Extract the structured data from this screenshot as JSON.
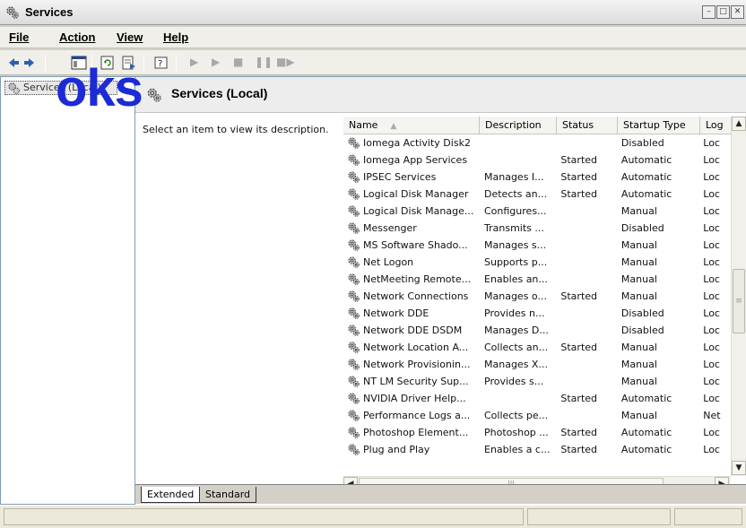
{
  "window": {
    "title": "Services",
    "buttons": [
      "minimize",
      "restore",
      "close"
    ]
  },
  "logo": {
    "text": "oks"
  },
  "menu": {
    "file": "File",
    "action": "Action",
    "view": "View",
    "help": "Help"
  },
  "toolbar": {
    "icons": [
      "back-icon",
      "forward-icon",
      "console-tree-icon",
      "refresh-icon",
      "export-icon",
      "help-icon",
      "start-icon",
      "play-icon",
      "stop-icon",
      "pause-icon",
      "restart-icon"
    ]
  },
  "tree": {
    "item_label": "Services (Local)"
  },
  "pane": {
    "title": "Services (Local)",
    "description": "Select an item to view its description."
  },
  "columns": {
    "name": "Name",
    "description": "Description",
    "status": "Status",
    "startup": "Startup Type",
    "logon": "Log"
  },
  "rows": [
    {
      "name": "Iomega Activity Disk2",
      "description": "",
      "status": "",
      "startup": "Disabled",
      "logon": "Loc"
    },
    {
      "name": "Iomega App Services",
      "description": "",
      "status": "Started",
      "startup": "Automatic",
      "logon": "Loc"
    },
    {
      "name": "IPSEC Services",
      "description": "Manages I...",
      "status": "Started",
      "startup": "Automatic",
      "logon": "Loc"
    },
    {
      "name": "Logical Disk Manager",
      "description": "Detects an...",
      "status": "Started",
      "startup": "Automatic",
      "logon": "Loc"
    },
    {
      "name": "Logical Disk Manage...",
      "description": "Configures...",
      "status": "",
      "startup": "Manual",
      "logon": "Loc"
    },
    {
      "name": "Messenger",
      "description": "Transmits ...",
      "status": "",
      "startup": "Disabled",
      "logon": "Loc"
    },
    {
      "name": "MS Software Shado...",
      "description": "Manages s...",
      "status": "",
      "startup": "Manual",
      "logon": "Loc"
    },
    {
      "name": "Net Logon",
      "description": "Supports p...",
      "status": "",
      "startup": "Manual",
      "logon": "Loc"
    },
    {
      "name": "NetMeeting Remote...",
      "description": "Enables an...",
      "status": "",
      "startup": "Manual",
      "logon": "Loc"
    },
    {
      "name": "Network Connections",
      "description": "Manages o...",
      "status": "Started",
      "startup": "Manual",
      "logon": "Loc"
    },
    {
      "name": "Network DDE",
      "description": "Provides n...",
      "status": "",
      "startup": "Disabled",
      "logon": "Loc"
    },
    {
      "name": "Network DDE DSDM",
      "description": "Manages D...",
      "status": "",
      "startup": "Disabled",
      "logon": "Loc"
    },
    {
      "name": "Network Location A...",
      "description": "Collects an...",
      "status": "Started",
      "startup": "Manual",
      "logon": "Loc"
    },
    {
      "name": "Network Provisionin...",
      "description": "Manages X...",
      "status": "",
      "startup": "Manual",
      "logon": "Loc"
    },
    {
      "name": "NT LM Security Sup...",
      "description": "Provides s...",
      "status": "",
      "startup": "Manual",
      "logon": "Loc"
    },
    {
      "name": "NVIDIA Driver Help...",
      "description": "",
      "status": "Started",
      "startup": "Automatic",
      "logon": "Loc"
    },
    {
      "name": "Performance Logs a...",
      "description": "Collects pe...",
      "status": "",
      "startup": "Manual",
      "logon": "Net"
    },
    {
      "name": "Photoshop Element...",
      "description": "Photoshop ...",
      "status": "Started",
      "startup": "Automatic",
      "logon": "Loc"
    },
    {
      "name": "Plug and Play",
      "description": "Enables a c...",
      "status": "Started",
      "startup": "Automatic",
      "logon": "Loc"
    }
  ],
  "tabs": {
    "extended": "Extended",
    "standard": "Standard"
  },
  "scroll": {
    "h_thumb_grip": "III",
    "v_thumb_grip": "≡"
  }
}
